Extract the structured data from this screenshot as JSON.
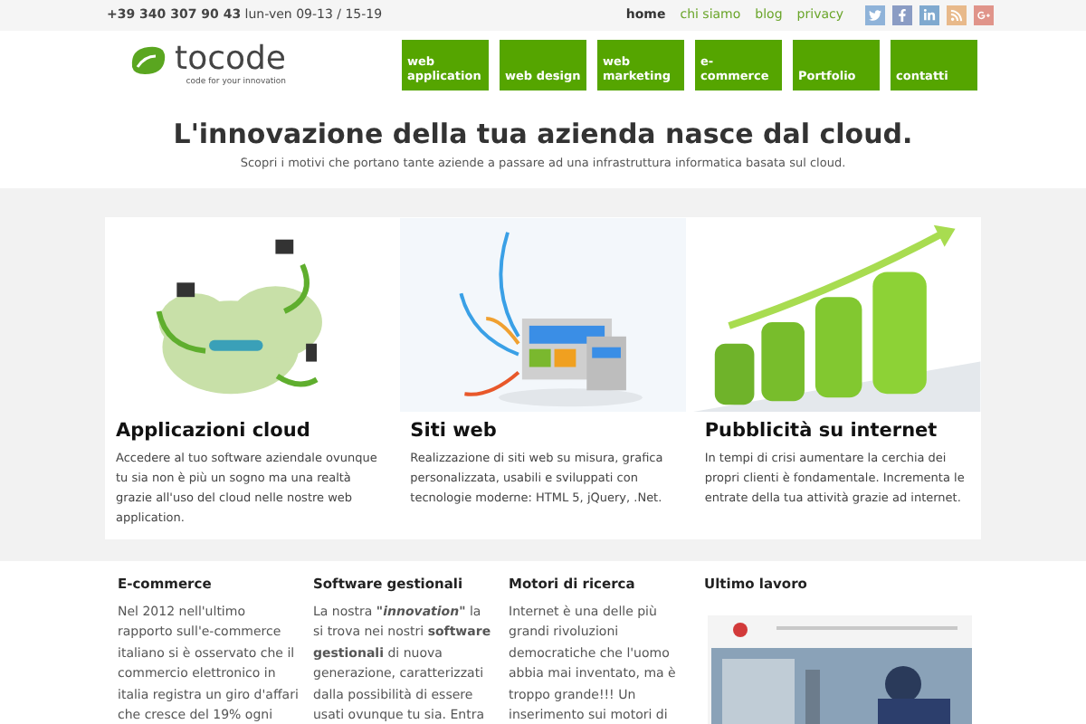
{
  "top_bar": {
    "phone": "+39 340 307 90 43",
    "hours": "lun-ven 09-13 / 15-19",
    "links": [
      {
        "label": "home",
        "selected": true
      },
      {
        "label": "chi siamo",
        "selected": false
      },
      {
        "label": "blog",
        "selected": false
      },
      {
        "label": "privacy",
        "selected": false
      }
    ],
    "social": [
      {
        "kind": "twitter",
        "color": "#8fb3d9"
      },
      {
        "kind": "facebook",
        "color": "#8a9cc4"
      },
      {
        "kind": "linkedin",
        "color": "#7fa9cf"
      },
      {
        "kind": "rss",
        "color": "#e8b98a"
      },
      {
        "kind": "googleplus",
        "color": "#e0948a"
      }
    ]
  },
  "logo": {
    "name": "tocode",
    "tagline": "code for your innovation"
  },
  "nav": [
    {
      "label": "web application"
    },
    {
      "label": "web design"
    },
    {
      "label": "web marketing"
    },
    {
      "label": "e-commerce"
    },
    {
      "label": "Portfolio"
    },
    {
      "label": "contatti"
    }
  ],
  "hero": {
    "title": "L'innovazione della tua azienda nasce dal cloud.",
    "subtitle": "Scopri i motivi che portano tante aziende a passare ad una infrastruttura informatica basata sul cloud."
  },
  "cards": [
    {
      "kind": "cloud",
      "title": "Applicazioni cloud",
      "text": "Accedere al tuo software aziendale ovunque tu sia non è più un sogno ma una realtà grazie all'uso del cloud nelle nostre web application."
    },
    {
      "kind": "devices",
      "title": "Siti web",
      "text": "Realizzazione di siti web su misura, grafica personalizzata, usabili e sviluppati con tecnologie moderne: HTML 5, jQuery, .Net."
    },
    {
      "kind": "growth",
      "title": "Pubblicità su internet",
      "text": "In tempi di crisi aumentare la cerchia dei propri clienti è fondamentale. Incrementa le entrate della tua attività grazie ad internet."
    }
  ],
  "columns": [
    {
      "title": "E-commerce",
      "lines": [
        "Nel 2012 nell'ultimo",
        "rapporto sull'e-commerce",
        "italiano si è osservato che il",
        "commercio elettronico in",
        "italia registra un giro d'affari",
        "che cresce del 19% ogni"
      ]
    },
    {
      "title": "Software gestionali",
      "lines": [
        "La nostra **\"*innovation*\"** la",
        "si trova nei nostri **software**",
        "**gestionali** di nuova",
        "generazione, caratterizzati",
        "dalla possibilità di essere",
        "usati ovunque tu sia. Entra"
      ]
    },
    {
      "title": "Motori di ricerca",
      "lines": [
        "Internet è una delle più",
        "grandi rivoluzioni",
        "democratiche che l'uomo",
        "abbia mai inventato, ma è",
        "troppo grande!!! Un",
        "inserimento sui motori di"
      ]
    }
  ],
  "latest_work": {
    "title": "Ultimo lavoro",
    "kind": "picture"
  }
}
